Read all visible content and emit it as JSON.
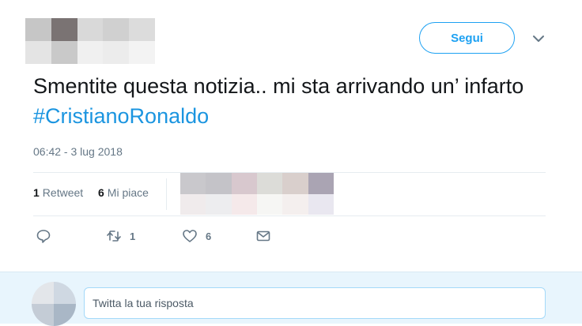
{
  "author": {
    "avatar_pixels": [
      "#c6c6c6",
      "#7a7373",
      "#d9d9d9",
      "#d0d0d0",
      "#dcdcdc",
      "#e4e4e4",
      "#c9c9c9",
      "#f0f0f0",
      "#ececec",
      "#f3f3f3"
    ]
  },
  "header": {
    "follow_label": "Segui",
    "more_icon": "chevron-down-icon"
  },
  "tweet": {
    "text": "Smentite questa notizia.. mi sta arrivando un’ infarto ",
    "hashtag": "#CristianoRonaldo",
    "timestamp": "06:42 - 3 lug 2018"
  },
  "stats": {
    "retweets_count": "1",
    "retweets_label": "Retweet",
    "likes_count": "6",
    "likes_label": "Mi piace",
    "likers_pixels": [
      "#c9c8cc",
      "#c4c3c8",
      "#d8c8ce",
      "#dcdcd8",
      "#d9cfcc",
      "#aaa4b3",
      "#f0ebec",
      "#ededef",
      "#f5e9ea",
      "#f6f6f4",
      "#f4efee",
      "#e9e7f0"
    ]
  },
  "actions": {
    "reply_icon": "reply-icon",
    "retweet_icon": "retweet-icon",
    "retweet_count": "1",
    "like_icon": "heart-icon",
    "like_count": "6",
    "dm_icon": "mail-icon"
  },
  "reply": {
    "placeholder": "Twitta la tua risposta",
    "avatar_pixels": [
      "#e3e6ea",
      "#cfd8e2",
      "#c4ccd6",
      "#a9b7c6"
    ]
  },
  "colors": {
    "accent": "#1da1f2",
    "hashtag": "#1b95e0",
    "muted": "#657786",
    "reply_bg": "#e8f5fd"
  }
}
